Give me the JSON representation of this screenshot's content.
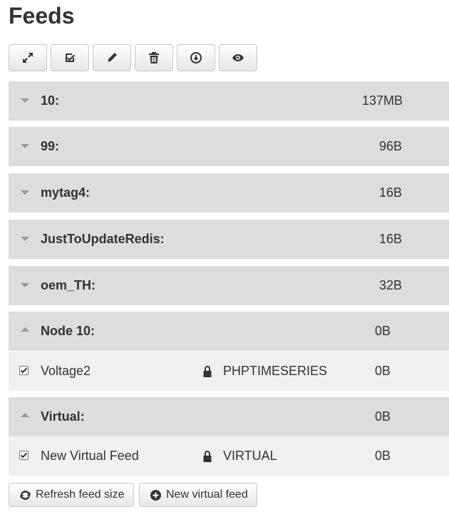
{
  "page": {
    "title": "Feeds"
  },
  "toolbar": {
    "buttons": [
      {
        "icon": "expand-icon"
      },
      {
        "icon": "select-all-icon"
      },
      {
        "icon": "edit-icon"
      },
      {
        "icon": "delete-icon"
      },
      {
        "icon": "download-icon"
      },
      {
        "icon": "view-icon"
      }
    ]
  },
  "nodes": [
    {
      "name": "10:",
      "size": "137MB",
      "expanded": false
    },
    {
      "name": "99:",
      "size": "96B",
      "expanded": false
    },
    {
      "name": "mytag4:",
      "size": "16B",
      "expanded": false
    },
    {
      "name": "JustToUpdateRedis:",
      "size": "16B",
      "expanded": false
    },
    {
      "name": "oem_TH:",
      "size": "32B",
      "expanded": false
    },
    {
      "name": "Node 10:",
      "size": "0B",
      "expanded": true,
      "feeds": [
        {
          "name": "Voltage2",
          "engine": "PHPTIMESERIES",
          "size": "0B",
          "checked": true
        }
      ]
    },
    {
      "name": "Virtual:",
      "size": "0B",
      "expanded": true,
      "feeds": [
        {
          "name": "New Virtual Feed",
          "engine": "VIRTUAL",
          "size": "0B",
          "checked": true
        }
      ]
    }
  ],
  "actions": {
    "refresh_label": "Refresh feed size",
    "new_virtual_label": "New virtual feed"
  },
  "colors": {
    "node_header_bg": "#dddddd",
    "feed_row_bg": "#f0f0f0",
    "text": "#333333"
  }
}
